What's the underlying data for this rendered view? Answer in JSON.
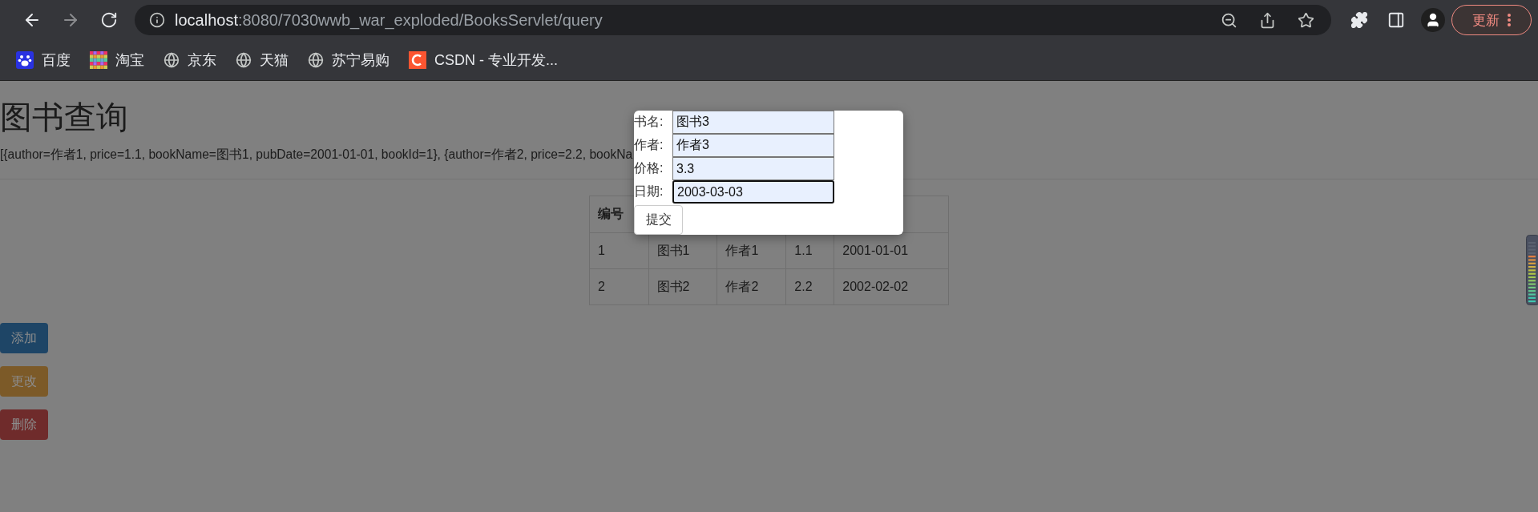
{
  "browser": {
    "url_host": "localhost",
    "url_path": ":8080/7030wwb_war_exploded/BooksServlet/query",
    "update_button": "更新",
    "bookmarks": [
      {
        "kind": "baidu",
        "label": "百度"
      },
      {
        "kind": "taobao",
        "label": "淘宝"
      },
      {
        "kind": "globe",
        "label": "京东"
      },
      {
        "kind": "globe",
        "label": "天猫"
      },
      {
        "kind": "globe",
        "label": "苏宁易购"
      },
      {
        "kind": "csdn",
        "label": "CSDN - 专业开发..."
      }
    ]
  },
  "page": {
    "heading": "图书查询",
    "data_text": "[{author=作者1, price=1.1, bookName=图书1, pubDate=2001-01-01, bookId=1}, {author=作者2, price=2.2, bookNa",
    "table": {
      "columns": [
        "编号"
      ],
      "rows": [
        [
          "1",
          "图书1",
          "作者1",
          "1.1",
          "2001-01-01"
        ],
        [
          "2",
          "图书2",
          "作者2",
          "2.2",
          "2002-02-02"
        ]
      ]
    },
    "buttons": [
      {
        "kind": "primary",
        "label": "添加"
      },
      {
        "kind": "warning",
        "label": "更改"
      },
      {
        "kind": "danger",
        "label": "删除"
      }
    ]
  },
  "dialog": {
    "fields": [
      {
        "label": "书名:",
        "value": "图书3",
        "focused": false
      },
      {
        "label": "作者:",
        "value": "作者3",
        "focused": false
      },
      {
        "label": "价格:",
        "value": "3.3",
        "focused": false
      },
      {
        "label": "日期:",
        "value": "2003-03-03",
        "focused": true
      }
    ],
    "submit": "提交"
  }
}
